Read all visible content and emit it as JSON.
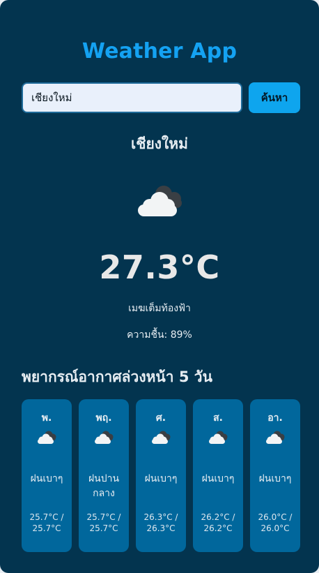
{
  "app": {
    "title": "Weather App"
  },
  "search": {
    "value": "เชียงใหม่",
    "button_label": "ค้นหา"
  },
  "current": {
    "city": "เชียงใหม่",
    "icon": "cloudy-icon",
    "temperature": "27.3°C",
    "description": "เมฆเต็มท้องฟ้า",
    "humidity": "ความชื้น: 89%"
  },
  "forecast": {
    "title": "พยากรณ์อากาศล่วงหน้า 5 วัน",
    "days": [
      {
        "day": "พ.",
        "icon": "rain-cloud-icon",
        "desc": "ฝนเบาๆ",
        "temp_line1": "25.7°C /",
        "temp_line2": "25.7°C"
      },
      {
        "day": "พฤ.",
        "icon": "rain-cloud-icon",
        "desc": "ฝนปานกลาง",
        "temp_line1": "25.7°C /",
        "temp_line2": "25.7°C"
      },
      {
        "day": "ศ.",
        "icon": "rain-cloud-icon",
        "desc": "ฝนเบาๆ",
        "temp_line1": "26.3°C /",
        "temp_line2": "26.3°C"
      },
      {
        "day": "ส.",
        "icon": "rain-cloud-icon",
        "desc": "ฝนเบาๆ",
        "temp_line1": "26.2°C /",
        "temp_line2": "26.2°C"
      },
      {
        "day": "อา.",
        "icon": "rain-cloud-icon",
        "desc": "ฝนเบาๆ",
        "temp_line1": "26.0°C /",
        "temp_line2": "26.0°C"
      }
    ]
  },
  "colors": {
    "background": "#03344f",
    "accent": "#14a2f2",
    "button": "#0ea5ee",
    "forecast_card": "#01679c"
  }
}
